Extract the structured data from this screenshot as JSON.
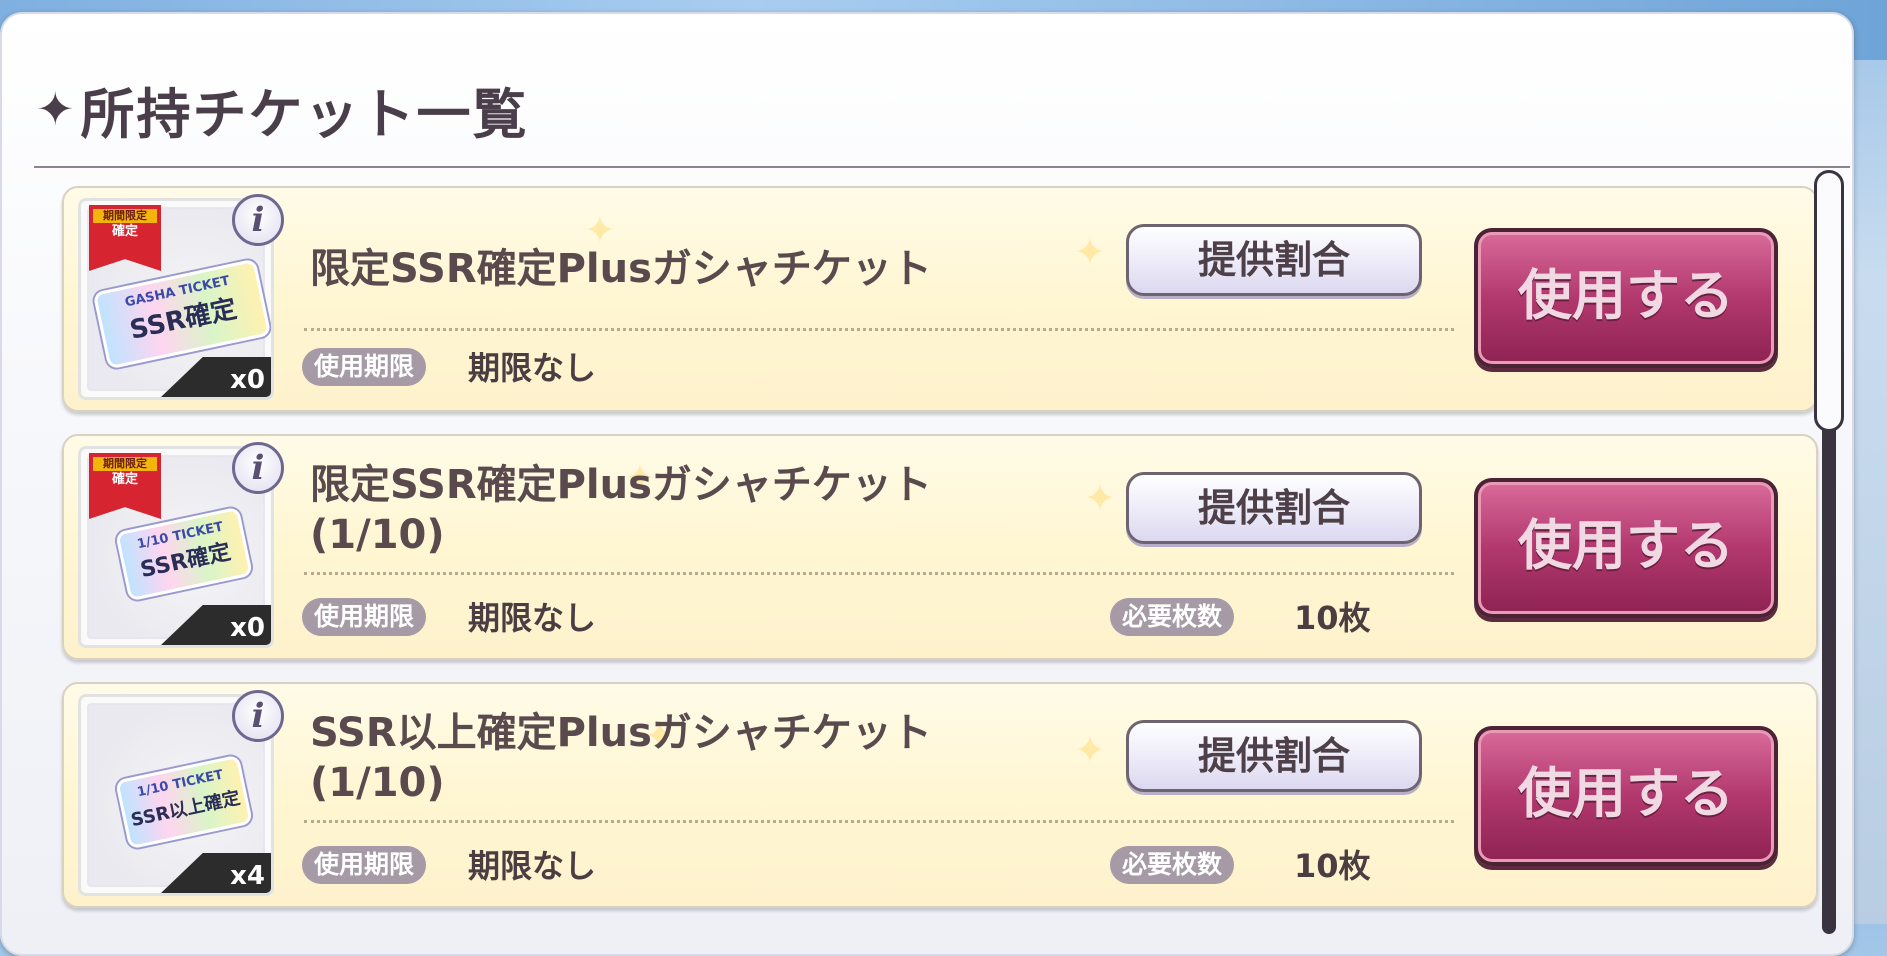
{
  "panel": {
    "title_icon": "sparkle-star-icon",
    "title_star_glyph": "✦",
    "title": "所持チケット一覧"
  },
  "tickets": [
    {
      "name": "限定SSR確定Plusガシャチケット",
      "ribbon_line1": "期間限定",
      "ribbon_line2": "確定",
      "ticket_top": "GASHA TICKET",
      "ticket_main": "SSR確定",
      "count": "x0",
      "info_icon": "i",
      "expiry_label": "使用期限",
      "expiry_value": "期限なし",
      "required_label": "",
      "required_value": "",
      "rate_button": "提供割合",
      "use_button": "使用する"
    },
    {
      "name": "限定SSR確定Plusガシャチケット(1/10)",
      "ribbon_line1": "期間限定",
      "ribbon_line2": "確定",
      "ticket_top": "1/10 TICKET",
      "ticket_main": "SSR確定",
      "count": "x0",
      "info_icon": "i",
      "expiry_label": "使用期限",
      "expiry_value": "期限なし",
      "required_label": "必要枚数",
      "required_value": "10枚",
      "rate_button": "提供割合",
      "use_button": "使用する"
    },
    {
      "name": "SSR以上確定Plusガシャチケット(1/10)",
      "ribbon_line1": "",
      "ribbon_line2": "",
      "ticket_top": "1/10 TICKET",
      "ticket_main": "SSR以上確定",
      "count": "x4",
      "info_icon": "i",
      "expiry_label": "使用期限",
      "expiry_value": "期限なし",
      "required_label": "必要枚数",
      "required_value": "10枚",
      "rate_button": "提供割合",
      "use_button": "使用する"
    }
  ],
  "colors": {
    "row_bg": "#fff6d2",
    "use_button": "#b2386e",
    "ribbon": "#d62430",
    "badge": "#a59aa6"
  }
}
